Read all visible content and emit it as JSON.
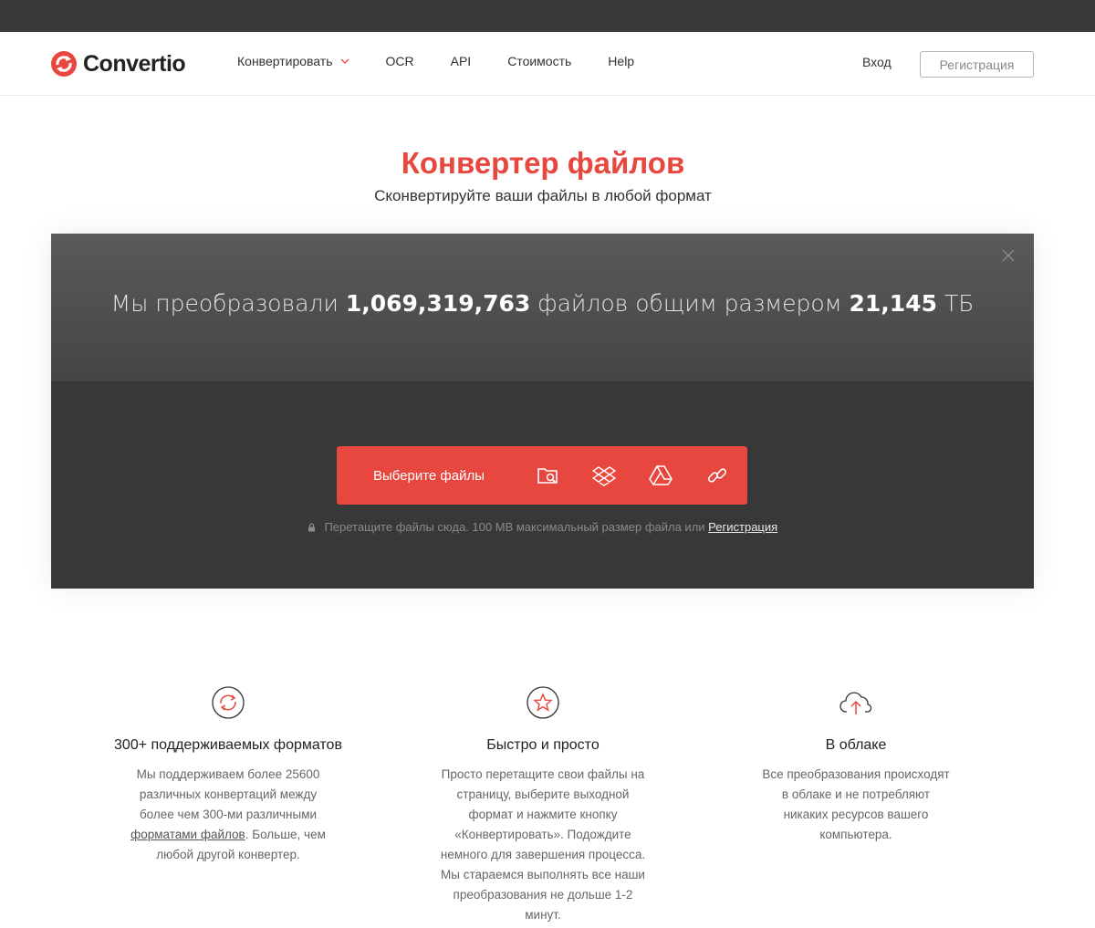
{
  "header": {
    "logo_text": "Convertio",
    "nav": {
      "convert": "Конвертировать",
      "ocr": "OCR",
      "api": "API",
      "pricing": "Стоимость",
      "help": "Help"
    },
    "login": "Вход",
    "signup": "Регистрация"
  },
  "hero": {
    "title": "Конвертер файлов",
    "subtitle": "Сконвертируйте ваши файлы в любой формат"
  },
  "stats": {
    "prefix": "Мы преобразовали",
    "files_count": "1,069,319,763",
    "middle": "файлов общим размером",
    "total_size": "21,145",
    "unit": "ТБ"
  },
  "upload": {
    "choose_label": "Выберите файлы",
    "sources": [
      "folder-search-icon",
      "dropbox-icon",
      "google-drive-icon",
      "link-icon"
    ],
    "drop_note": "Перетащите файлы сюда. 100 MB максимальный размер файла или",
    "drop_note_link": "Регистрация"
  },
  "features": [
    {
      "icon": "convert-cycle-icon",
      "title": "300+ поддерживаемых форматов",
      "text_before_link": "Мы поддерживаем более 25600 различных конвертаций между более чем 300-ми различными",
      "link": "форматами файлов",
      "text_after_link": ". Больше, чем любой другой конвертер."
    },
    {
      "icon": "star-icon",
      "title": "Быстро и просто",
      "text": "Просто перетащите свои файлы на страницу, выберите выходной формат и нажмите кнопку «Конвертировать». Подождите немного для завершения процесса. Мы стараемся выполнять все наши преобразования не дольше 1-2 минут."
    },
    {
      "icon": "cloud-upload-icon",
      "title": "В облаке",
      "text": "Все преобразования происходят в облаке и не потребляют никаких ресурсов вашего компьютера."
    }
  ],
  "colors": {
    "accent": "#e8473f",
    "topbar": "#3a3a3a",
    "panel": "#383838"
  }
}
